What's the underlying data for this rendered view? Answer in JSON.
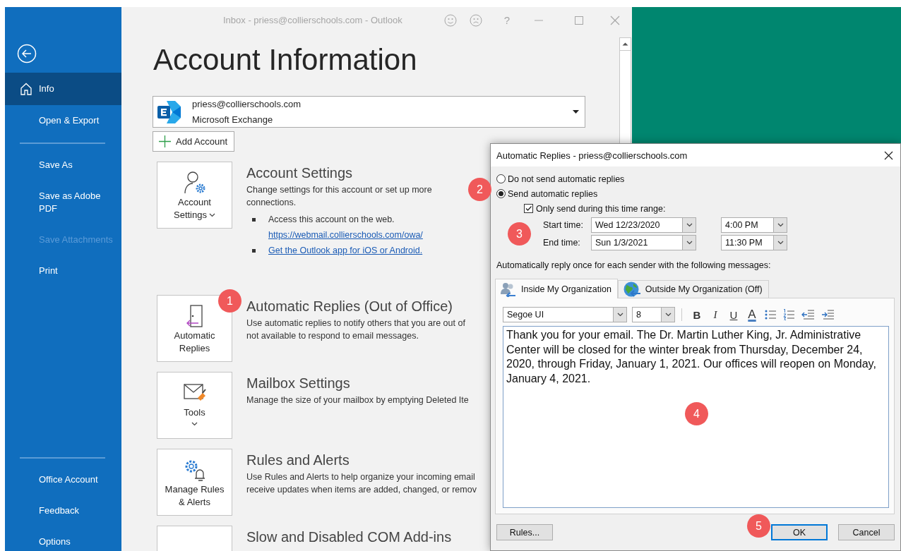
{
  "window": {
    "title": "Inbox - priess@collierschools.com - Outlook",
    "help": "?"
  },
  "sidebar": {
    "groups": [
      {
        "items": [
          {
            "label": "Info",
            "selected": true,
            "disabled": false
          },
          {
            "label": "Open & Export",
            "selected": false,
            "disabled": false
          }
        ]
      },
      {
        "items": [
          {
            "label": "Save As",
            "selected": false,
            "disabled": false
          },
          {
            "label": "Save as Adobe PDF",
            "selected": false,
            "disabled": false
          },
          {
            "label": "Save Attachments",
            "selected": false,
            "disabled": true
          },
          {
            "label": "Print",
            "selected": false,
            "disabled": false
          }
        ]
      }
    ],
    "footer_items": [
      {
        "label": "Office Account",
        "selected": false,
        "disabled": false
      },
      {
        "label": "Feedback",
        "selected": false,
        "disabled": false
      },
      {
        "label": "Options",
        "selected": false,
        "disabled": false
      }
    ]
  },
  "page_title": "Account Information",
  "account": {
    "email": "priess@collierschools.com",
    "type": "Microsoft Exchange"
  },
  "add_account": "Add Account",
  "sections": [
    {
      "kind": "account",
      "button": "Account Settings",
      "dropdown": true,
      "heading": "Account Settings",
      "description_lines": [
        "Change settings for this account or set up more",
        "connections."
      ],
      "bullets": [
        {
          "text": "Access this account on the web.",
          "link": "https://webmail.collierschools.com/owa/"
        },
        {
          "link": "Get the Outlook app for iOS or Android."
        }
      ]
    },
    {
      "kind": "auto_reply",
      "button": "Automatic Replies",
      "dropdown": false,
      "heading": "Automatic Replies (Out of Office)",
      "description_lines": [
        "Use automatic replies to notify others that you are out of",
        "not available to respond to email messages."
      ]
    },
    {
      "kind": "tools",
      "button": "Tools",
      "dropdown": true,
      "heading": "Mailbox Settings",
      "description_lines": [
        "Manage the size of your mailbox by emptying Deleted Ite"
      ]
    },
    {
      "kind": "rules",
      "button": "Manage Rules & Alerts",
      "dropdown": false,
      "heading": "Rules and Alerts",
      "description_lines": [
        "Use Rules and Alerts to help organize your incoming email",
        "receive updates when items are added, changed, or remov"
      ]
    },
    {
      "kind": "addins",
      "heading": "Slow and Disabled COM Add-ins"
    }
  ],
  "dialog": {
    "title": "Automatic Replies - priess@collierschools.com",
    "options": [
      {
        "label": "Do not send automatic replies",
        "selected": false
      },
      {
        "label": "Send automatic replies",
        "selected": true
      }
    ],
    "time_range": {
      "label": "Only send during this time range:",
      "checked": true
    },
    "times": [
      {
        "label": "Start time:",
        "date": "Wed 12/23/2020",
        "time": "4:00 PM"
      },
      {
        "label": "End time:",
        "date": "Sun 1/3/2021",
        "time": "11:30 PM"
      }
    ],
    "message_label": "Automatically reply once for each sender with the following messages:",
    "tabs": [
      {
        "kind": "inside",
        "label": "Inside My Organization",
        "selected": true
      },
      {
        "kind": "outside",
        "label": "Outside My Organization (Off)",
        "selected": false
      }
    ],
    "font": "Segoe UI",
    "size": "8",
    "format_buttons": [
      {
        "kind": "bold",
        "label": "B"
      },
      {
        "kind": "italic",
        "label": "I"
      },
      {
        "kind": "underline",
        "label": "U"
      },
      {
        "kind": "color",
        "label": "A"
      }
    ],
    "message": "Thank you for your email. The Dr. Martin Luther King, Jr. Administrative Center will be closed for the winter break from Thursday, December 24, 2020, through Friday, January 1, 2021. Our offices will reopen on Monday, January 4, 2021.",
    "buttons": [
      {
        "kind": "rules",
        "label": "Rules..."
      },
      {
        "kind": "ok",
        "label": "OK"
      },
      {
        "kind": "cancel",
        "label": "Cancel"
      }
    ]
  },
  "annotations": [
    "1",
    "2",
    "3",
    "4",
    "5"
  ]
}
